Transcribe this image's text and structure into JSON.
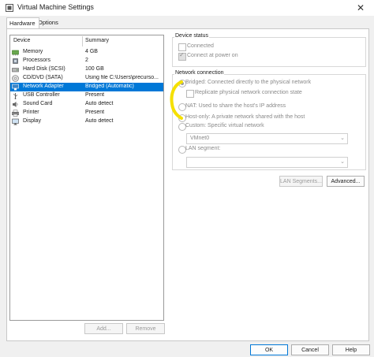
{
  "window": {
    "title": "Virtual Machine Settings",
    "close_symbol": "✕"
  },
  "tabs": [
    {
      "label": "Hardware"
    },
    {
      "label": "Options"
    }
  ],
  "device_list": {
    "headers": {
      "device": "Device",
      "summary": "Summary"
    },
    "rows": [
      {
        "name": "Memory",
        "summary": "4 GB",
        "icon": "memory-icon"
      },
      {
        "name": "Processors",
        "summary": "2",
        "icon": "processor-icon"
      },
      {
        "name": "Hard Disk (SCSI)",
        "summary": "100 GB",
        "icon": "hard-disk-icon"
      },
      {
        "name": "CD/DVD (SATA)",
        "summary": "Using file C:\\Users\\precurso...",
        "icon": "cd-dvd-icon"
      },
      {
        "name": "Network Adapter",
        "summary": "Bridged (Automatic)",
        "icon": "network-adapter-icon",
        "selected": true
      },
      {
        "name": "USB Controller",
        "summary": "Present",
        "icon": "usb-icon"
      },
      {
        "name": "Sound Card",
        "summary": "Auto detect",
        "icon": "sound-card-icon"
      },
      {
        "name": "Printer",
        "summary": "Present",
        "icon": "printer-icon"
      },
      {
        "name": "Display",
        "summary": "Auto detect",
        "icon": "display-icon"
      }
    ],
    "add_label": "Add...",
    "remove_label": "Remove"
  },
  "device_status": {
    "legend": "Device status",
    "connected": {
      "label": "Connected",
      "checked": false
    },
    "connect_at_power_on": {
      "label": "Connect at power on",
      "checked": true
    }
  },
  "network_connection": {
    "legend": "Network connection",
    "bridged": "Bridged: Connected directly to the physical network",
    "replicate": "Replicate physical network connection state",
    "nat": "NAT: Used to share the host's IP address",
    "host_only": "Host-only: A private network shared with the host",
    "custom": "Custom: Specific virtual network",
    "custom_value": "VMnet0",
    "lan_segment": "LAN segment:",
    "lan_segment_value": "",
    "selected": "bridged"
  },
  "buttons": {
    "lan_segments": "LAN Segments...",
    "advanced": "Advanced...",
    "ok": "OK",
    "cancel": "Cancel",
    "help": "Help"
  },
  "annotation_color": "#f5e000"
}
